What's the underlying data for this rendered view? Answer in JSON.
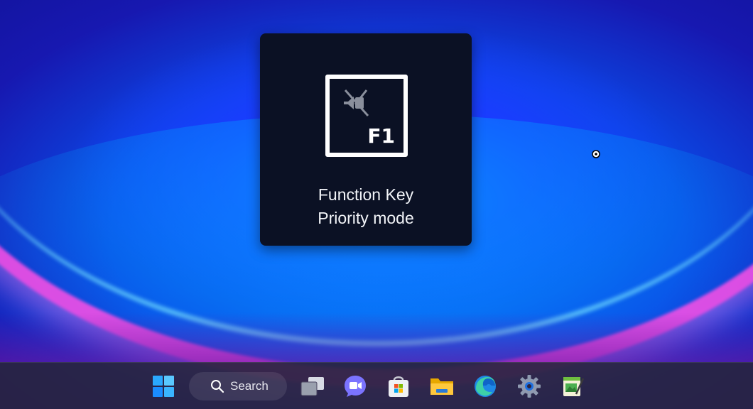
{
  "osd": {
    "key_label": "F1",
    "title_line1": "Function Key",
    "title_line2": "Priority mode",
    "icon": "media-muted-icon"
  },
  "taskbar": {
    "search_label": "Search",
    "items": [
      {
        "name": "start-button",
        "icon": "windows-logo-icon"
      },
      {
        "name": "search-box",
        "icon": "search-icon"
      },
      {
        "name": "task-view-button",
        "icon": "task-view-icon"
      },
      {
        "name": "teams-chat-button",
        "icon": "video-chat-icon"
      },
      {
        "name": "microsoft-store-button",
        "icon": "store-icon"
      },
      {
        "name": "file-explorer-button",
        "icon": "folder-icon"
      },
      {
        "name": "edge-browser-button",
        "icon": "edge-icon"
      },
      {
        "name": "settings-button",
        "icon": "gear-icon"
      },
      {
        "name": "notepad-app-button",
        "icon": "notepad-icon"
      }
    ]
  },
  "colors": {
    "osd_background": "#0b1124",
    "taskbar_background": "#2a2440",
    "accent_blue": "#1a8cff",
    "wallpaper_magenta": "#ff50e6"
  }
}
